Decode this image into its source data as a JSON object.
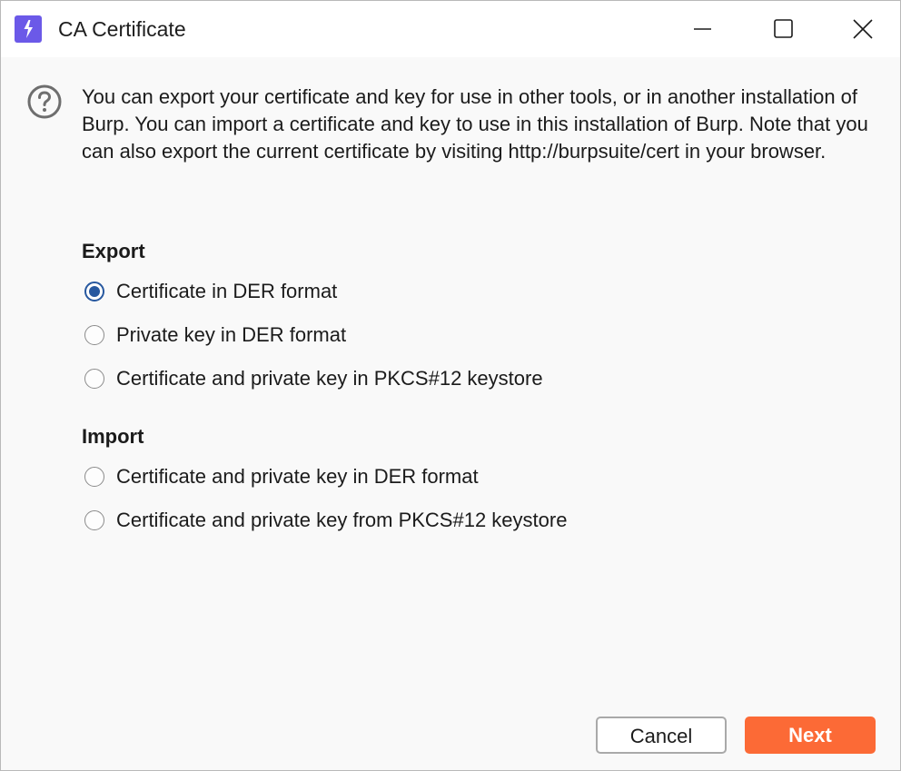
{
  "window": {
    "title": "CA Certificate",
    "app_icon": "burp-lightning-icon",
    "controls": [
      "minimize-icon",
      "maximize-icon",
      "close-icon"
    ]
  },
  "help_icon": "question-circle-icon",
  "intro_text": "You can export your certificate and key for use in other tools, or in another installation of Burp. You can import a certificate and key to use in this installation of Burp. Note that you can also export the current certificate by visiting http://burpsuite/cert in your browser.",
  "export": {
    "heading": "Export",
    "options": [
      {
        "label": "Certificate in DER format",
        "selected": true
      },
      {
        "label": "Private key in DER format",
        "selected": false
      },
      {
        "label": "Certificate and private key in PKCS#12 keystore",
        "selected": false
      }
    ]
  },
  "import": {
    "heading": "Import",
    "options": [
      {
        "label": "Certificate and private key in DER format",
        "selected": false
      },
      {
        "label": "Certificate and private key from PKCS#12 keystore",
        "selected": false
      }
    ]
  },
  "buttons": {
    "cancel": "Cancel",
    "next": "Next"
  },
  "colors": {
    "accent": "#fc6a36",
    "app_icon": "#6b59e8",
    "radio_selected": "#27589f"
  }
}
